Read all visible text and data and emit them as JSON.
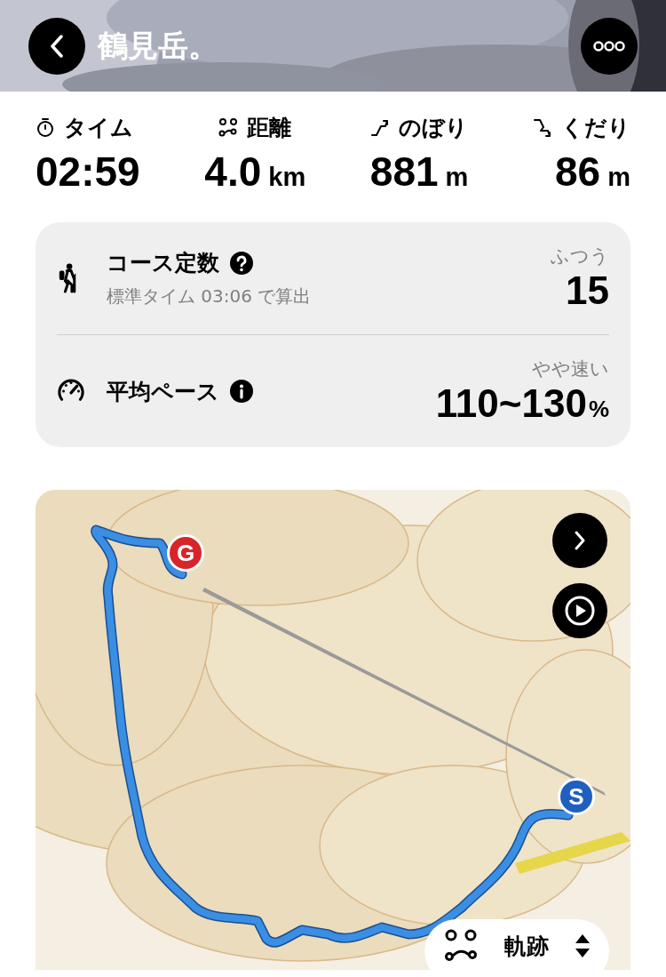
{
  "header": {
    "title": "鶴見岳。"
  },
  "stats": [
    {
      "kind": "time",
      "label": "タイム",
      "value": "02:59"
    },
    {
      "kind": "distance",
      "label": "距離",
      "value": "4.0",
      "unit": "km"
    },
    {
      "kind": "ascent",
      "label": "のぼり",
      "value": "881",
      "unit": "m"
    },
    {
      "kind": "descent",
      "label": "くだり",
      "value": "86",
      "unit": "m"
    }
  ],
  "summary": [
    {
      "kind": "course",
      "label": "コース定数",
      "note": "標準タイム 03:06 で算出",
      "rating": "ふつう",
      "value": "15"
    },
    {
      "kind": "pace",
      "label": "平均ペース",
      "rating": "やや速い",
      "value": "110~130",
      "unit": "%"
    }
  ],
  "map": {
    "markers": [
      {
        "kind": "start",
        "label": "S"
      },
      {
        "kind": "goal",
        "label": "G"
      }
    ],
    "layer": {
      "label": "軌跡"
    }
  }
}
